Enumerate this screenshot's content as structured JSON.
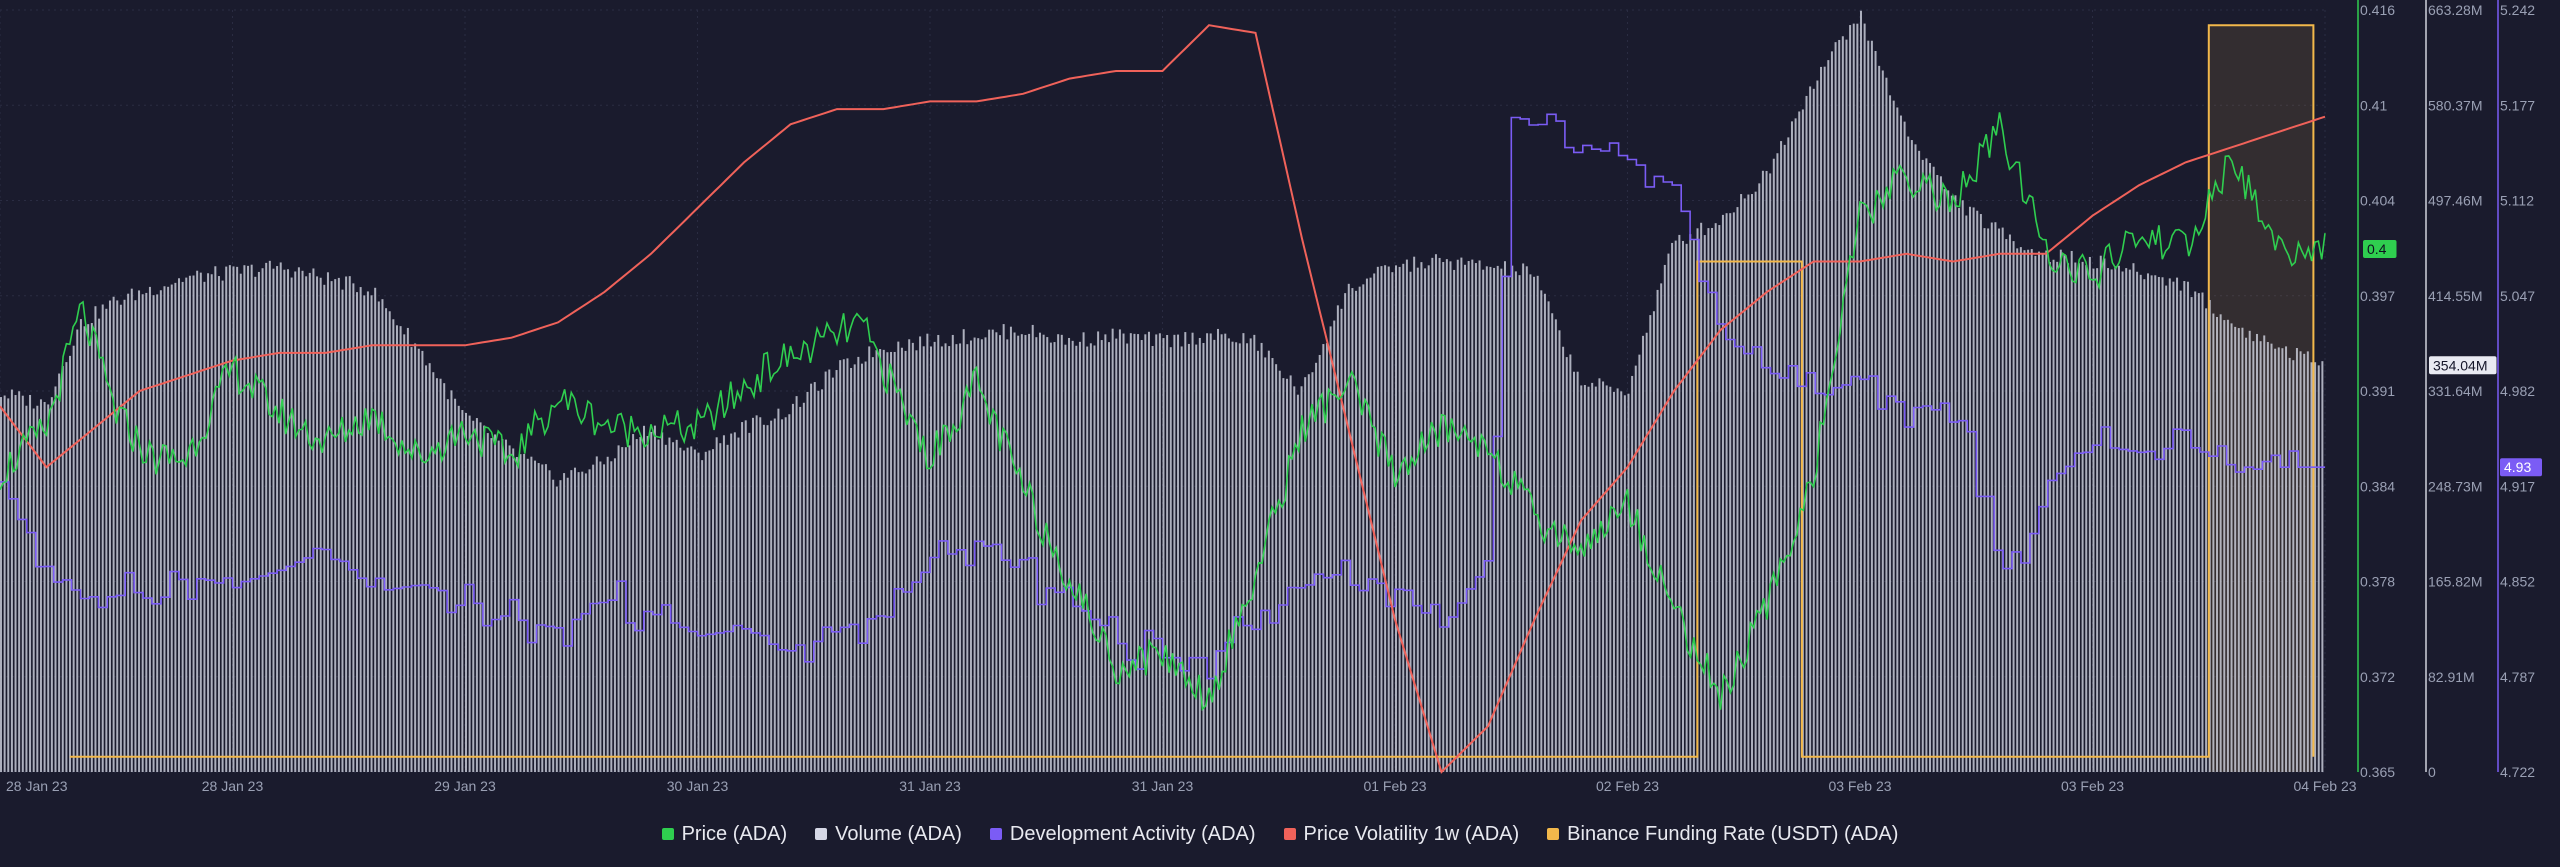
{
  "colors": {
    "background": "#1a1b2d",
    "price": "#2fce4f",
    "volume": "#d6d8e6",
    "dev_activity": "#7b5cf5",
    "volatility": "#f0625a",
    "funding": "#f2b84b",
    "text": "#9aa0b4"
  },
  "chart_data": {
    "type": "line",
    "x_ticks": [
      "28 Jan 23",
      "28 Jan 23",
      "29 Jan 23",
      "30 Jan 23",
      "31 Jan 23",
      "31 Jan 23",
      "01 Feb 23",
      "02 Feb 23",
      "03 Feb 23",
      "03 Feb 23",
      "04 Feb 23"
    ],
    "axes": {
      "price": {
        "ticks": [
          "0.416",
          "0.41",
          "0.404",
          "0.397",
          "0.391",
          "0.384",
          "0.378",
          "0.372",
          "0.365"
        ],
        "range": [
          0.365,
          0.416
        ]
      },
      "volume": {
        "ticks": [
          "663.28M",
          "580.37M",
          "497.46M",
          "414.55M",
          "331.64M",
          "248.73M",
          "165.82M",
          "82.91M",
          "0"
        ],
        "range": [
          0,
          663.28
        ]
      },
      "dev_activity": {
        "ticks": [
          "5.242",
          "5.177",
          "5.112",
          "5.047",
          "4.982",
          "4.917",
          "4.852",
          "4.787",
          "4.722"
        ],
        "range": [
          4.722,
          5.242
        ]
      }
    },
    "current_labels": {
      "price": "0.4",
      "volume": "354.04M",
      "dev_activity": "4.93"
    },
    "series": [
      {
        "name": "Price (ADA)",
        "axis": "price",
        "x": [
          0,
          0.02,
          0.035,
          0.05,
          0.065,
          0.08,
          0.1,
          0.12,
          0.14,
          0.16,
          0.18,
          0.2,
          0.22,
          0.24,
          0.265,
          0.3,
          0.33,
          0.37,
          0.4,
          0.42,
          0.44,
          0.46,
          0.48,
          0.5,
          0.52,
          0.54,
          0.56,
          0.58,
          0.6,
          0.62,
          0.64,
          0.66,
          0.68,
          0.7,
          0.72,
          0.74,
          0.76,
          0.78,
          0.8,
          0.82,
          0.84,
          0.86,
          0.87,
          0.88,
          0.9,
          0.92,
          0.94,
          0.96,
          0.98,
          1.0
        ],
        "values": [
          0.385,
          0.388,
          0.396,
          0.389,
          0.386,
          0.386,
          0.392,
          0.389,
          0.387,
          0.389,
          0.386,
          0.388,
          0.386,
          0.39,
          0.388,
          0.388,
          0.392,
          0.395,
          0.386,
          0.391,
          0.384,
          0.378,
          0.372,
          0.373,
          0.37,
          0.378,
          0.388,
          0.391,
          0.385,
          0.388,
          0.387,
          0.382,
          0.38,
          0.383,
          0.376,
          0.37,
          0.376,
          0.385,
          0.402,
          0.405,
          0.403,
          0.408,
          0.404,
          0.4,
          0.398,
          0.401,
          0.4,
          0.406,
          0.4,
          0.4
        ]
      },
      {
        "name": "Volume (ADA)",
        "axis": "volume",
        "x": [
          0,
          0.02,
          0.035,
          0.05,
          0.08,
          0.1,
          0.12,
          0.14,
          0.16,
          0.18,
          0.2,
          0.22,
          0.24,
          0.26,
          0.28,
          0.3,
          0.32,
          0.34,
          0.36,
          0.38,
          0.4,
          0.42,
          0.44,
          0.46,
          0.48,
          0.5,
          0.52,
          0.54,
          0.56,
          0.58,
          0.6,
          0.62,
          0.64,
          0.66,
          0.68,
          0.7,
          0.72,
          0.74,
          0.76,
          0.78,
          0.8,
          0.82,
          0.84,
          0.86,
          0.88,
          0.9,
          0.92,
          0.94,
          0.96,
          0.98,
          1.0
        ],
        "values": [
          330,
          320,
          390,
          410,
          430,
          435,
          440,
          430,
          420,
          370,
          310,
          280,
          255,
          270,
          300,
          275,
          300,
          315,
          350,
          370,
          375,
          380,
          385,
          375,
          380,
          375,
          380,
          375,
          330,
          420,
          440,
          445,
          440,
          435,
          340,
          330,
          460,
          480,
          520,
          600,
          660,
          560,
          500,
          470,
          450,
          445,
          435,
          425,
          390,
          370,
          354
        ]
      },
      {
        "name": "Development Activity (ADA)",
        "axis": "dev_activity",
        "x": [
          0,
          0.02,
          0.04,
          0.06,
          0.08,
          0.1,
          0.12,
          0.14,
          0.16,
          0.18,
          0.2,
          0.22,
          0.24,
          0.26,
          0.28,
          0.3,
          0.32,
          0.34,
          0.36,
          0.38,
          0.4,
          0.42,
          0.44,
          0.46,
          0.48,
          0.5,
          0.52,
          0.54,
          0.56,
          0.58,
          0.6,
          0.62,
          0.64,
          0.65,
          0.66,
          0.68,
          0.7,
          0.72,
          0.74,
          0.76,
          0.78,
          0.8,
          0.82,
          0.84,
          0.86,
          0.87,
          0.88,
          0.9,
          0.92,
          0.94,
          0.96,
          0.98,
          1.0
        ],
        "values": [
          4.92,
          4.86,
          4.84,
          4.845,
          4.855,
          4.85,
          4.86,
          4.875,
          4.845,
          4.85,
          4.84,
          4.825,
          4.82,
          4.84,
          4.83,
          4.815,
          4.82,
          4.8,
          4.82,
          4.83,
          4.865,
          4.88,
          4.855,
          4.84,
          4.81,
          4.8,
          4.8,
          4.83,
          4.85,
          4.86,
          4.845,
          4.82,
          4.87,
          5.16,
          5.18,
          5.15,
          5.14,
          5.12,
          5.02,
          4.995,
          4.98,
          4.99,
          4.97,
          4.975,
          4.86,
          4.865,
          4.92,
          4.945,
          4.94,
          4.945,
          4.93,
          4.93,
          4.93
        ]
      },
      {
        "name": "Price Volatility 1w (ADA)",
        "axis": "relative",
        "x": [
          0,
          0.02,
          0.04,
          0.06,
          0.08,
          0.1,
          0.12,
          0.14,
          0.16,
          0.18,
          0.2,
          0.22,
          0.24,
          0.26,
          0.28,
          0.3,
          0.32,
          0.34,
          0.36,
          0.38,
          0.4,
          0.42,
          0.44,
          0.46,
          0.48,
          0.5,
          0.52,
          0.54,
          0.56,
          0.58,
          0.6,
          0.62,
          0.64,
          0.66,
          0.68,
          0.7,
          0.72,
          0.74,
          0.76,
          0.78,
          0.8,
          0.82,
          0.84,
          0.86,
          0.88,
          0.9,
          0.92,
          0.94,
          0.96,
          0.98,
          1.0
        ],
        "values": [
          0.48,
          0.4,
          0.45,
          0.5,
          0.52,
          0.54,
          0.55,
          0.55,
          0.56,
          0.56,
          0.56,
          0.57,
          0.59,
          0.63,
          0.68,
          0.74,
          0.8,
          0.85,
          0.87,
          0.87,
          0.88,
          0.88,
          0.89,
          0.91,
          0.92,
          0.92,
          0.98,
          0.97,
          0.7,
          0.45,
          0.2,
          0.0,
          0.06,
          0.2,
          0.33,
          0.4,
          0.5,
          0.58,
          0.63,
          0.67,
          0.67,
          0.68,
          0.67,
          0.68,
          0.68,
          0.73,
          0.77,
          0.8,
          0.82,
          0.84,
          0.86
        ]
      },
      {
        "name": "Binance Funding Rate (USDT) (ADA)",
        "axis": "relative",
        "x": [
          0.03,
          0.73,
          0.73,
          0.775,
          0.775,
          0.95,
          0.95,
          0.995,
          0.995
        ],
        "values": [
          0.02,
          0.02,
          0.67,
          0.67,
          0.02,
          0.02,
          0.98,
          0.98,
          0.02
        ]
      }
    ],
    "legend": [
      "Price (ADA)",
      "Volume (ADA)",
      "Development Activity (ADA)",
      "Price Volatility 1w (ADA)",
      "Binance Funding Rate (USDT) (ADA)"
    ],
    "legend_position": "bottom-center",
    "grid": true
  }
}
